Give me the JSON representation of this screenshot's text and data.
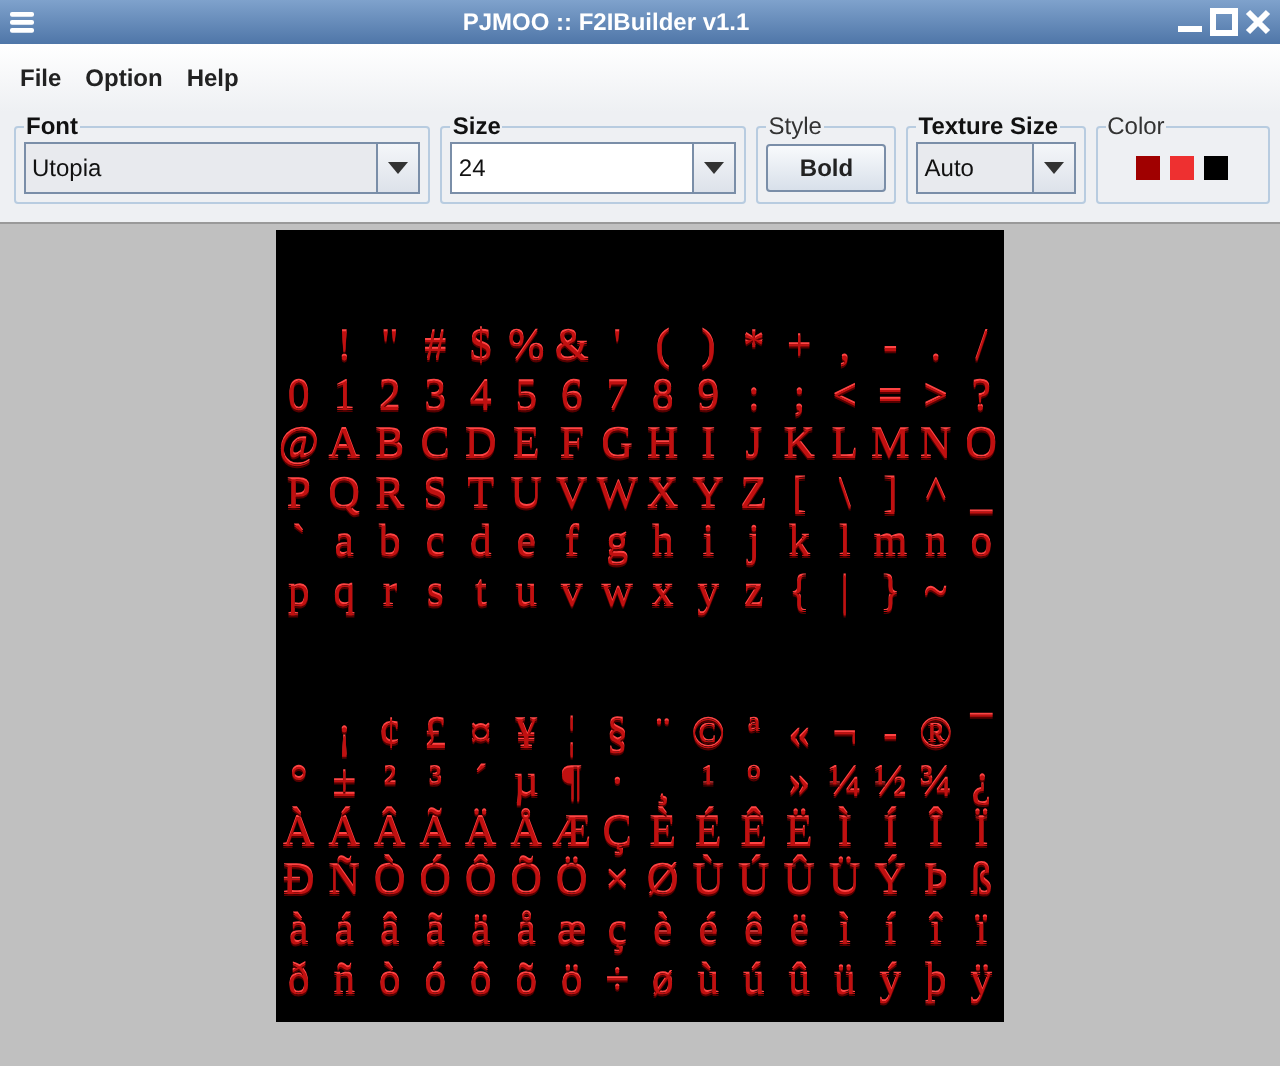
{
  "window": {
    "title": "PJMOO :: F2IBuilder v1.1"
  },
  "menu": [
    "File",
    "Option",
    "Help"
  ],
  "toolbar": [
    {
      "kind": "combo",
      "title": "Font",
      "bold_title": true,
      "value": "Utopia",
      "editable": false
    },
    {
      "kind": "combo",
      "title": "Size",
      "bold_title": true,
      "value": "24",
      "editable": true
    },
    {
      "kind": "button",
      "title": "Style",
      "bold_title": false,
      "label": "Bold"
    },
    {
      "kind": "combo",
      "title": "Texture Size",
      "bold_title": true,
      "value": "Auto",
      "editable": false
    },
    {
      "kind": "swatches",
      "title": "Color",
      "bold_title": false,
      "colors": [
        {
          "color": "#a00000"
        },
        {
          "color": "#ee3030"
        },
        {
          "color": "#000000"
        }
      ]
    }
  ],
  "texture": {
    "blocks": [
      [
        [
          {
            "kind": "blank"
          },
          "!",
          "\"",
          "#",
          "$",
          "%",
          "&",
          "'",
          "(",
          ")",
          "*",
          "+",
          ",",
          "-",
          ".",
          "/"
        ],
        [
          "0",
          "1",
          "2",
          "3",
          "4",
          "5",
          "6",
          "7",
          "8",
          "9",
          ":",
          ";",
          "<",
          "=",
          ">",
          "?"
        ],
        [
          "@",
          "A",
          "B",
          "C",
          "D",
          "E",
          "F",
          "G",
          "H",
          "I",
          "J",
          "K",
          "L",
          "M",
          "N",
          "O"
        ],
        [
          "P",
          "Q",
          "R",
          "S",
          "T",
          "U",
          "V",
          "W",
          "X",
          "Y",
          "Z",
          "[",
          "\\",
          "]",
          "^",
          "_"
        ],
        [
          "`",
          "a",
          "b",
          "c",
          "d",
          "e",
          "f",
          "g",
          "h",
          "i",
          "j",
          "k",
          "l",
          "m",
          "n",
          "o"
        ],
        [
          "p",
          "q",
          "r",
          "s",
          "t",
          "u",
          "v",
          "w",
          "x",
          "y",
          "z",
          "{",
          "|",
          "}",
          "~",
          {
            "kind": "blank"
          }
        ]
      ],
      [
        [
          {
            "kind": "blank"
          },
          "¡",
          "¢",
          "£",
          "¤",
          "¥",
          "¦",
          "§",
          "¨",
          "©",
          "ª",
          "«",
          "¬",
          "-",
          "®",
          "¯"
        ],
        [
          "°",
          "±",
          "²",
          "³",
          "´",
          "µ",
          "¶",
          "·",
          "¸",
          "¹",
          "º",
          "»",
          "¼",
          "½",
          "¾",
          "¿"
        ],
        [
          "À",
          "Á",
          "Â",
          "Ã",
          "Ä",
          "Å",
          "Æ",
          "Ç",
          "È",
          "É",
          "Ê",
          "Ë",
          "Ì",
          "Í",
          "Î",
          "Ï"
        ],
        [
          "Ð",
          "Ñ",
          "Ò",
          "Ó",
          "Ô",
          "Õ",
          "Ö",
          "×",
          "Ø",
          "Ù",
          "Ú",
          "Û",
          "Ü",
          "Ý",
          "Þ",
          "ß"
        ],
        [
          "à",
          "á",
          "â",
          "ã",
          "ä",
          "å",
          "æ",
          "ç",
          "è",
          "é",
          "ê",
          "ë",
          "ì",
          "í",
          "î",
          "ï"
        ],
        [
          "ð",
          "ñ",
          "ò",
          "ó",
          "ô",
          "õ",
          "ö",
          "÷",
          "ø",
          "ù",
          "ú",
          "û",
          "ü",
          "ý",
          "þ",
          "ÿ"
        ]
      ]
    ]
  }
}
